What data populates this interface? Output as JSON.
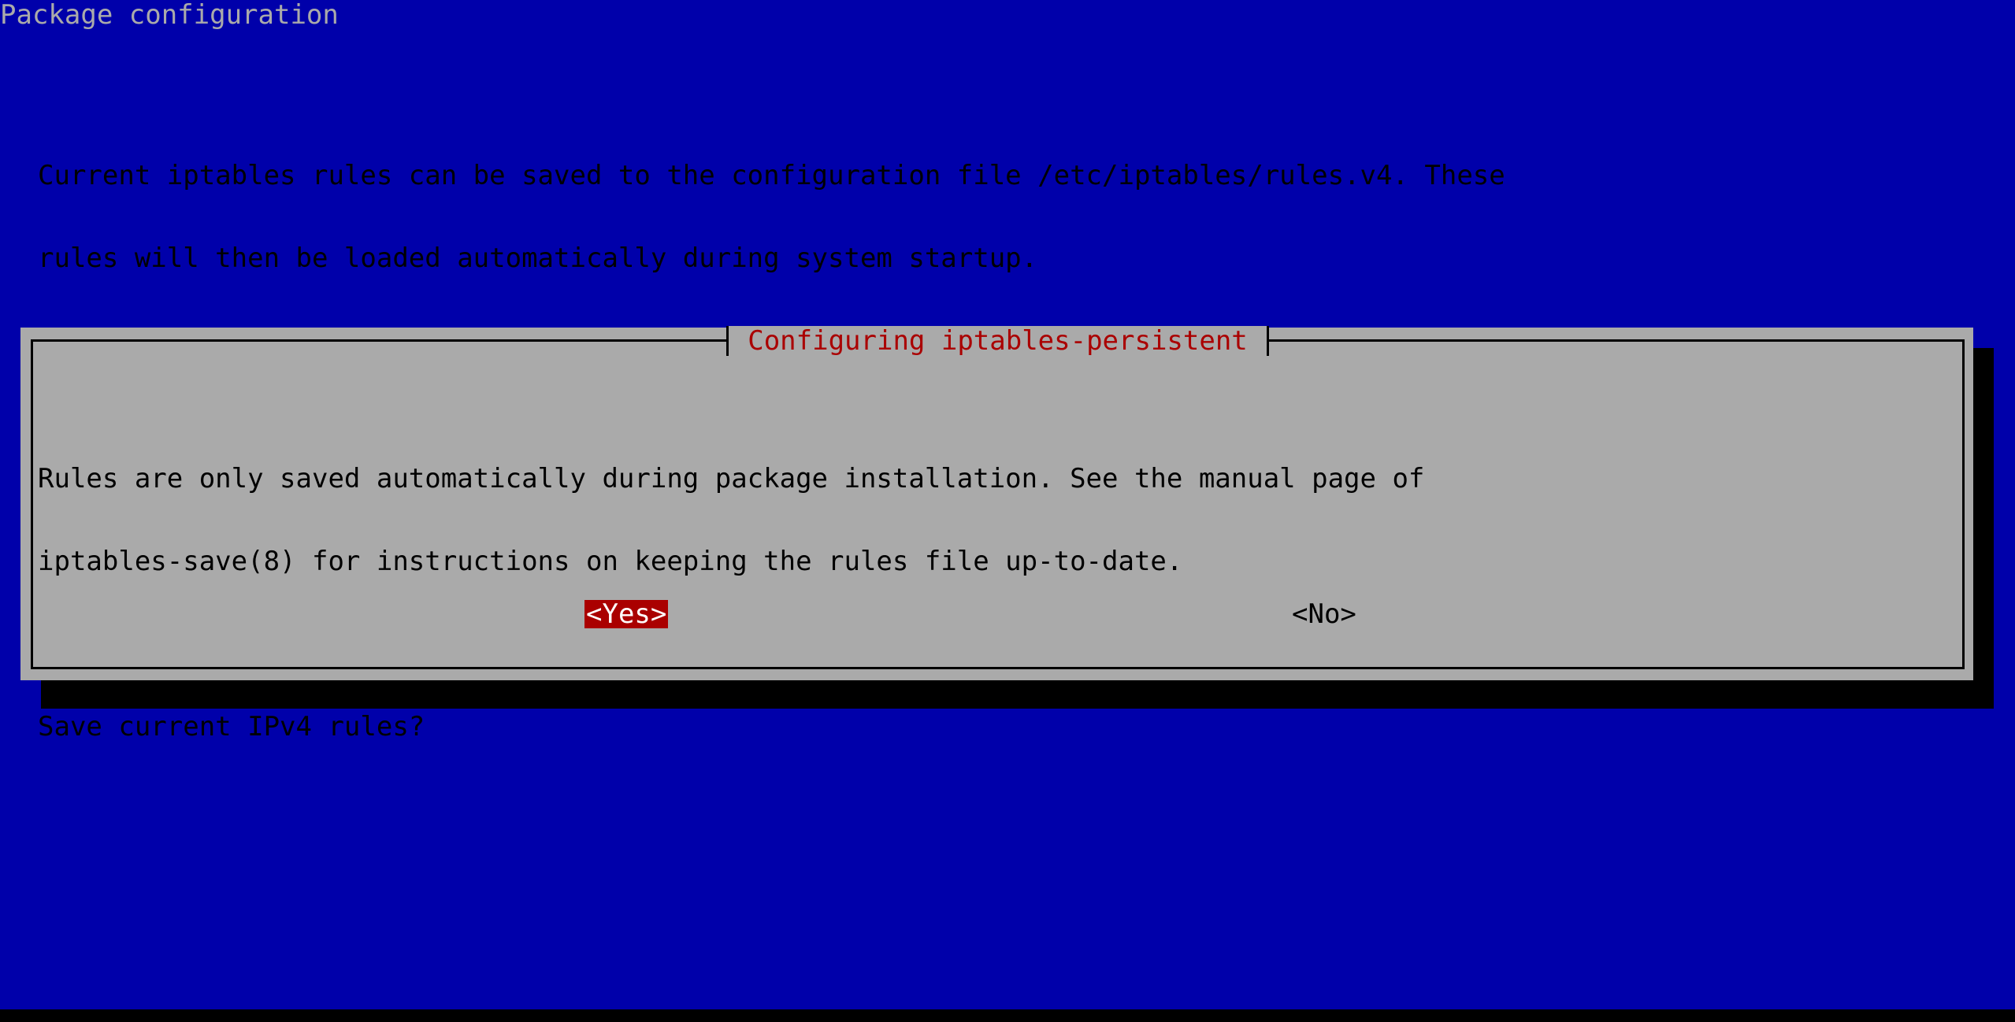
{
  "backtitle": "Package configuration",
  "dialog": {
    "title": "Configuring iptables-persistent",
    "paragraphs": {
      "p1_line1": "Current iptables rules can be saved to the configuration file /etc/iptables/rules.v4. These",
      "p1_line2": "rules will then be loaded automatically during system startup.",
      "p2_line1": "Rules are only saved automatically during package installation. See the manual page of",
      "p2_line2": "iptables-save(8) for instructions on keeping the rules file up-to-date.",
      "question": "Save current IPv4 rules?"
    },
    "buttons": {
      "yes": "<Yes>",
      "no": "<No>",
      "selected": "yes"
    }
  },
  "colors": {
    "background": "#0000aa",
    "dialog": "#aaaaaa",
    "title_text": "#aa0000",
    "selected_button_bg": "#aa0000",
    "selected_button_text": "#ffffff",
    "shadow": "#000000"
  }
}
